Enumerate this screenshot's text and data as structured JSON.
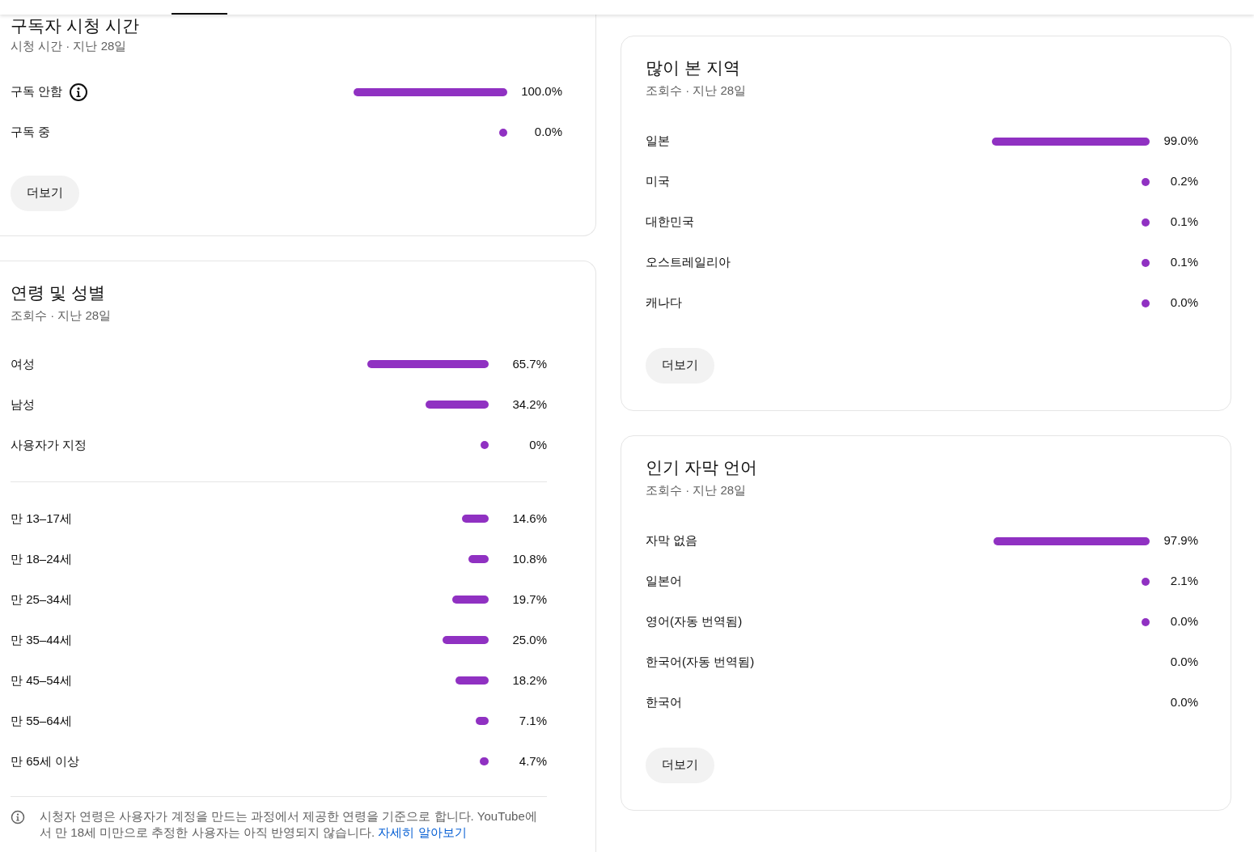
{
  "header": {
    "tabs": [
      {
        "selected": true
      }
    ]
  },
  "subscriber_watch_time": {
    "title": "구독자 시청 시간",
    "subtitle": "시청 시간 · 지난 28일",
    "rows": [
      {
        "label": "구독 안함",
        "info": true,
        "kind": "bar",
        "level": 1.0,
        "reading": "100.0%"
      },
      {
        "label": "구독 중",
        "info": false,
        "kind": "bar",
        "level": 0.0,
        "reading": "0.0%"
      }
    ],
    "more_button": "더보기"
  },
  "age_gender": {
    "title": "연령 및 성별",
    "subtitle": "조회수 · 지난 28일",
    "groups": [
      [
        {
          "label": "여성",
          "kind": "bar",
          "level": 0.657,
          "reading": "65.7%"
        },
        {
          "label": "남성",
          "kind": "bar",
          "level": 0.342,
          "reading": "34.2%"
        },
        {
          "label": "사용자가 지정",
          "kind": "bar",
          "level": 0.0,
          "reading": "0%"
        }
      ],
      [
        {
          "label": "만 13–17세",
          "kind": "bar",
          "level": 0.146,
          "reading": "14.6%"
        },
        {
          "label": "만 18–24세",
          "kind": "bar",
          "level": 0.108,
          "reading": "10.8%"
        },
        {
          "label": "만 25–34세",
          "kind": "bar",
          "level": 0.197,
          "reading": "19.7%"
        },
        {
          "label": "만 35–44세",
          "kind": "bar",
          "level": 0.25,
          "reading": "25.0%"
        },
        {
          "label": "만 45–54세",
          "kind": "bar",
          "level": 0.182,
          "reading": "18.2%"
        },
        {
          "label": "만 55–64세",
          "kind": "bar",
          "level": 0.071,
          "reading": "7.1%"
        },
        {
          "label": "만 65세 이상",
          "kind": "bar",
          "level": 0.047,
          "reading": "4.7%"
        }
      ]
    ],
    "note": "시청자 연령은 사용자가 계정을 만드는 과정에서 제공한 연령을 기준으로 합니다. YouTube에서 만 18세 미만으로 추정한 사용자는 아직 반영되지 않습니다.",
    "note_link": "자세히 알아보기"
  },
  "top_regions": {
    "title": "많이 본 지역",
    "subtitle": "조회수 · 지난 28일",
    "rows": [
      {
        "label": "일본",
        "kind": "bar",
        "level": 0.99,
        "reading": "99.0%"
      },
      {
        "label": "미국",
        "kind": "bar",
        "level": 0.002,
        "reading": "0.2%"
      },
      {
        "label": "대한민국",
        "kind": "bar",
        "level": 0.001,
        "reading": "0.1%"
      },
      {
        "label": "오스트레일리아",
        "kind": "bar",
        "level": 0.001,
        "reading": "0.1%"
      },
      {
        "label": "캐나다",
        "kind": "bar",
        "level": 0.0,
        "reading": "0.0%"
      }
    ],
    "more_button": "더보기"
  },
  "top_subtitle_languages": {
    "title": "인기 자막 언어",
    "subtitle": "조회수 · 지난 28일",
    "rows": [
      {
        "label": "자막 없음",
        "kind": "bar",
        "level": 0.979,
        "reading": "97.9%"
      },
      {
        "label": "일본어",
        "kind": "bar",
        "level": 0.021,
        "reading": "2.1%"
      },
      {
        "label": "영어(자동 번역됨)",
        "kind": "bar",
        "level": 0.0,
        "reading": "0.0%"
      },
      {
        "label": "한국어(자동 번역됨)",
        "kind": "none",
        "reading": "0.0%"
      },
      {
        "label": "한국어",
        "kind": "none",
        "reading": "0.0%"
      }
    ],
    "more_button": "더보기"
  }
}
